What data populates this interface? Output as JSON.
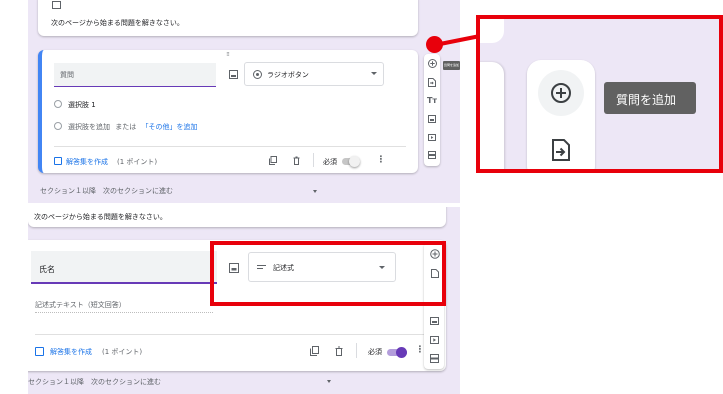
{
  "colors": {
    "accent": "#4285f4",
    "purple": "#673ab7",
    "callout": "#e8000b",
    "panel_bg": "#ede7f6"
  },
  "top": {
    "section_hint": "次のページから始まる問題を解きなさい。",
    "question": {
      "title_placeholder": "質問",
      "type_label": "ラジオボタン",
      "option1": "選択肢 1",
      "add_option": "選択肢を追加",
      "or_text": "または",
      "add_other": "「その他」を追加",
      "answer_key": "解答集を作成",
      "points": "(1 ポイント)",
      "required": "必須",
      "required_on": false
    },
    "tooltip": "質問を追加",
    "section_nav": "セクション１以降　次のセクションに進む"
  },
  "zoom": {
    "tooltip": "質問を追加"
  },
  "bottom": {
    "section_hint": "次のページから始まる問題を解きなさい。",
    "question": {
      "title": "氏名",
      "type_label": "記述式",
      "answer_placeholder": "記述式テキスト（短文回答）",
      "answer_key": "解答集を作成",
      "points": "(1 ポイント)",
      "required": "必須",
      "required_on": true
    },
    "section_nav": "セクション１以降　次のセクションに進む"
  },
  "icons": [
    "add-circle-icon",
    "import-icon",
    "title-icon",
    "image-icon",
    "video-icon",
    "section-icon",
    "more-vert-icon",
    "copy-icon",
    "delete-icon",
    "checkbox-icon",
    "drag-handle-icon",
    "chevron-down-icon",
    "radio-icon",
    "short-text-icon"
  ]
}
